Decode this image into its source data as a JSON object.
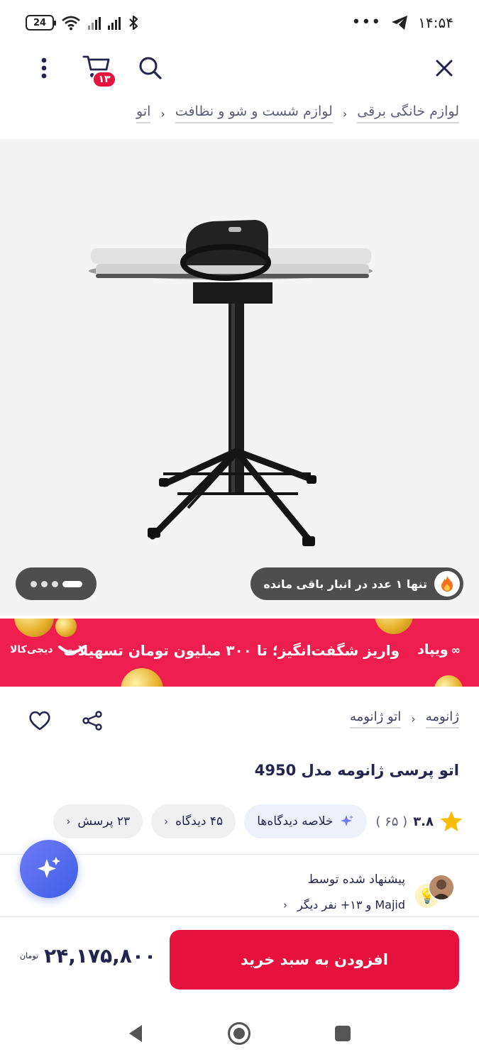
{
  "status_bar": {
    "time": "۱۴:۵۴",
    "battery": "24"
  },
  "toolbar": {
    "cart_count": "۱۳"
  },
  "breadcrumb": {
    "items": [
      "لوازم خانگی برقی",
      "لوازم شست و شو و نظافت",
      "اتو"
    ]
  },
  "gallery": {
    "stock_notice": "تنها ۱ عدد در انبار باقی مانده"
  },
  "promo": {
    "brand": "ویپاد",
    "text": "واریز شگفت‌انگیز؛ تا ۳۰۰ میلیون تومان تسهیلات",
    "partner": "دیجی‌کالا"
  },
  "product": {
    "brand": "ژانومه",
    "category_link": "اتو ژانومه",
    "title": "اتو پرسی ژانومه مدل 4950",
    "rating": "۳.۸",
    "rating_count": "( ۶۵ )",
    "summary_chip": "خلاصه دیدگاه‌ها",
    "reviews_chip": "۴۵ دیدگاه",
    "questions_chip": "۲۳ پرسش"
  },
  "recommend": {
    "title": "پیشنهاد شده توسط",
    "by": "Majid و ۱۳+ نفر دیگر"
  },
  "purchase": {
    "add_to_cart": "افزودن به سبد خرید",
    "price": "۲۴,۱۷۵,۸۰۰",
    "currency": "تومان"
  },
  "colors": {
    "primary": "#e6123d",
    "promo_bg": "#ee1f4f",
    "text": "#23254e",
    "ai_fab": "#4f6af0"
  }
}
